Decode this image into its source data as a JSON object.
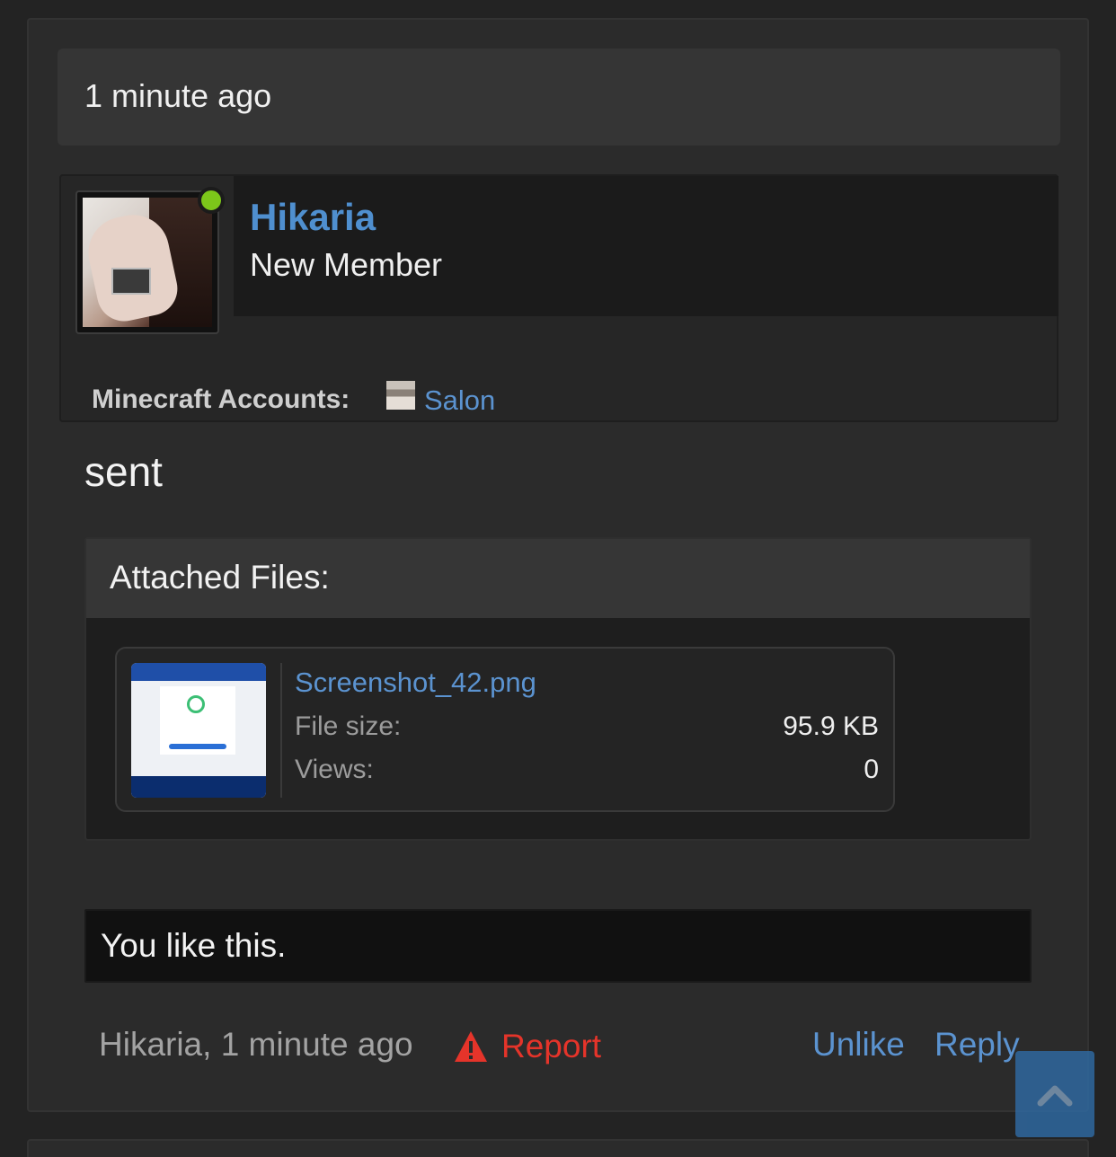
{
  "post": {
    "header_time": "1 minute ago",
    "author": {
      "username": "Hikaria",
      "role": "New Member",
      "online": true,
      "minecraft_label": "Minecraft Accounts:",
      "minecraft_account": "Salon"
    },
    "body": "sent",
    "attachments": {
      "title": "Attached Files:",
      "files": [
        {
          "name": "Screenshot_42.png",
          "size_label": "File size:",
          "size": "95.9 KB",
          "views_label": "Views:",
          "views": "0"
        }
      ]
    },
    "likes_text": "You like this.",
    "footer": {
      "meta": "Hikaria, 1 minute ago",
      "report": "Report",
      "unlike": "Unlike",
      "reply": "Reply"
    }
  },
  "colors": {
    "link": "#5b93d0",
    "report": "#e5342a",
    "online": "#7cc61a",
    "scroll_button": "#2f6aa3"
  },
  "icons": {
    "online": "online-status-dot",
    "report": "warning-triangle-icon",
    "scroll_top": "chevron-up-icon"
  }
}
